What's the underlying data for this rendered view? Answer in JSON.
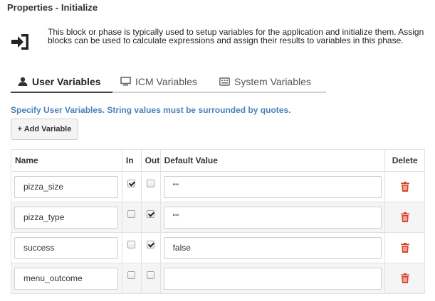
{
  "header": {
    "title": "Properties - Initialize",
    "description": "This block or phase is typically used to setup variables for the application and initialize them. Assign blocks can be used to calculate expressions and assign their results to variables in this phase."
  },
  "tabs": [
    {
      "label": "User Variables",
      "icon": "user-icon",
      "active": true
    },
    {
      "label": "ICM Variables",
      "icon": "monitor-icon",
      "active": false
    },
    {
      "label": "System Variables",
      "icon": "keyboard-icon",
      "active": false
    }
  ],
  "hint": "Specify User Variables. String values must be surrounded by quotes.",
  "add_button": "+ Add Variable",
  "table": {
    "columns": [
      "Name",
      "In",
      "Out",
      "Default Value",
      "Delete"
    ],
    "rows": [
      {
        "name": "pizza_size",
        "in": true,
        "out": false,
        "default": "\"\""
      },
      {
        "name": "pizza_type",
        "in": false,
        "out": true,
        "default": "\"\""
      },
      {
        "name": "success",
        "in": false,
        "out": true,
        "default": "false"
      },
      {
        "name": "menu_outcome",
        "in": false,
        "out": false,
        "default": ""
      }
    ]
  },
  "colors": {
    "accent_text": "#4a82b8",
    "delete": "#d9452b"
  }
}
